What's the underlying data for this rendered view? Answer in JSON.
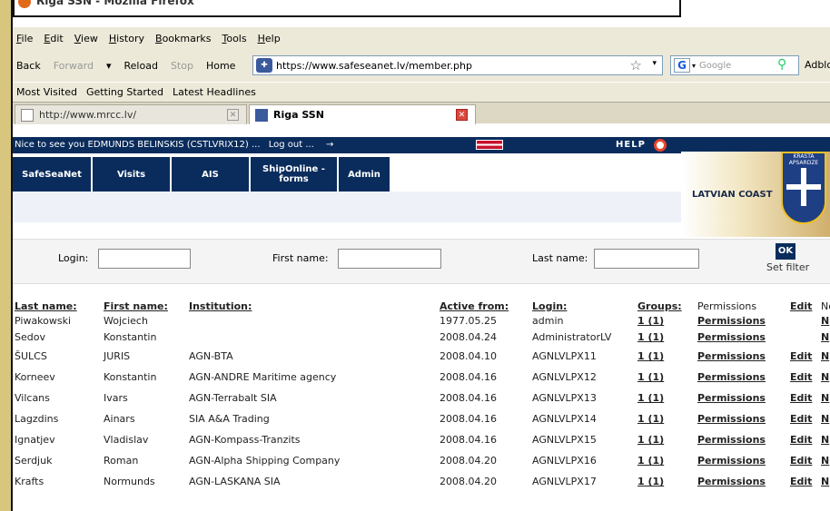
{
  "window": {
    "title": "Riga SSN - Mozilla Firefox"
  },
  "menu": [
    "File",
    "Edit",
    "View",
    "History",
    "Bookmarks",
    "Tools",
    "Help"
  ],
  "navbar": {
    "back": "Back",
    "forward": "Forward",
    "reload": "Reload",
    "stop": "Stop",
    "home": "Home",
    "url": "https://www.safeseanet.lv/member.php",
    "search_engine": "G",
    "search_placeholder": "Google",
    "adblock": "Adblo"
  },
  "bookmarks": [
    "Most Visited",
    "Getting Started",
    "Latest Headlines"
  ],
  "tabs": [
    {
      "label": "http://www.mrcc.lv/"
    },
    {
      "label": "Riga SSN"
    }
  ],
  "header": {
    "welcome": "Nice to see you EDMUNDS BELINSKIS (CSTLVRIX12) ...",
    "logout": "Log out ...",
    "arrow": "→",
    "help": "HELP"
  },
  "nav": [
    {
      "label": "SafeSeaNet"
    },
    {
      "label": "Visits"
    },
    {
      "label": "AIS"
    },
    {
      "label": "ShipOnline - forms"
    },
    {
      "label": "Admin"
    }
  ],
  "brand": {
    "coast_text": "LATVIAN COAST",
    "crest_text": "KRASTA APSARDZE",
    "accent": "#0a2c5c"
  },
  "filter": {
    "login_label": "Login:",
    "first_label": "First name:",
    "last_label": "Last name:",
    "ok": "OK",
    "set_filter": "Set filter"
  },
  "table": {
    "headers": {
      "last": "Last name:",
      "first": "First name:",
      "inst": "Institution:",
      "active": "Active from:",
      "login": "Login:",
      "groups": "Groups:",
      "perm": "Permissions",
      "edit": "Edit",
      "n": "No"
    },
    "rows": [
      {
        "last": "Piwakowski",
        "first": "Wojciech",
        "inst": "",
        "active": "1977.05.25",
        "login": "admin",
        "groups": "1 (1)",
        "perm": "Permissions",
        "edit": "",
        "n": "N"
      },
      {
        "last": "Sedov",
        "first": "Konstantin",
        "inst": "",
        "active": "2008.04.24",
        "login": "AdministratorLV",
        "groups": "1 (1)",
        "perm": "Permissions",
        "edit": "",
        "n": "N"
      },
      {
        "last": "ŠULCS",
        "first": "JURIS",
        "inst": "AGN-BTA",
        "active": "2008.04.10",
        "login": "AGNLVLPX11",
        "groups": "1 (1)",
        "perm": "Permissions",
        "edit": "Edit",
        "n": "N"
      },
      {
        "last": "Korneev",
        "first": "Konstantin",
        "inst": "AGN-ANDRE Maritime agency",
        "active": "2008.04.16",
        "login": "AGNLVLPX12",
        "groups": "1 (1)",
        "perm": "Permissions",
        "edit": "Edit",
        "n": "N"
      },
      {
        "last": "Vilcans",
        "first": "Ivars",
        "inst": "AGN-Terrabalt SIA",
        "active": "2008.04.16",
        "login": "AGNLVLPX13",
        "groups": "1 (1)",
        "perm": "Permissions",
        "edit": "Edit",
        "n": "N"
      },
      {
        "last": "Lagzdins",
        "first": "Ainars",
        "inst": "SIA A&A Trading",
        "active": "2008.04.16",
        "login": "AGNLVLPX14",
        "groups": "1 (1)",
        "perm": "Permissions",
        "edit": "Edit",
        "n": "N"
      },
      {
        "last": "Ignatjev",
        "first": "Vladislav",
        "inst": "AGN-Kompass-Tranzits",
        "active": "2008.04.16",
        "login": "AGNLVLPX15",
        "groups": "1 (1)",
        "perm": "Permissions",
        "edit": "Edit",
        "n": "N"
      },
      {
        "last": "Serdjuk",
        "first": "Roman",
        "inst": "AGN-Alpha Shipping Company",
        "active": "2008.04.20",
        "login": "AGNLVLPX16",
        "groups": "1 (1)",
        "perm": "Permissions",
        "edit": "Edit",
        "n": "N"
      },
      {
        "last": "Krafts",
        "first": "Normunds",
        "inst": "AGN-LASKANA SIA",
        "active": "2008.04.20",
        "login": "AGNLVLPX17",
        "groups": "1 (1)",
        "perm": "Permissions",
        "edit": "Edit",
        "n": "N"
      }
    ]
  }
}
